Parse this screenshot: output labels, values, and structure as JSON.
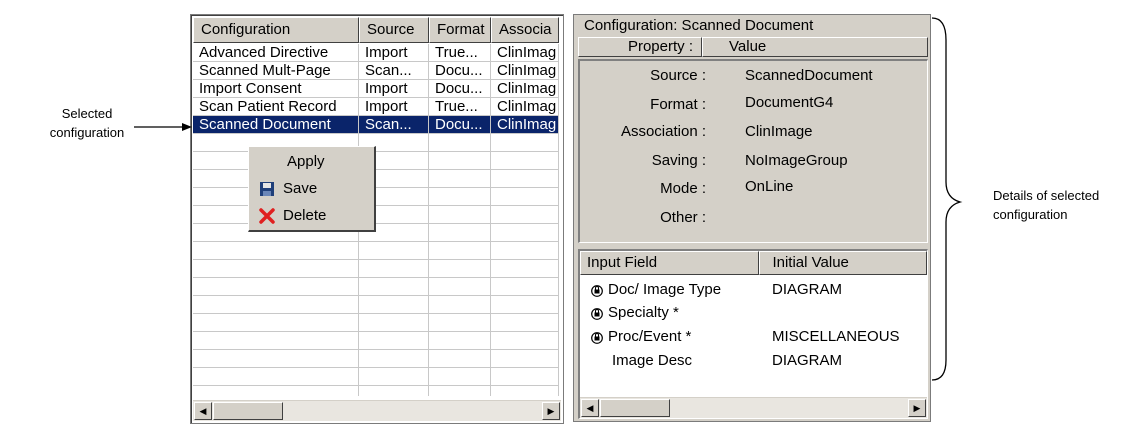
{
  "grid": {
    "columns": [
      "Configuration",
      "Source",
      "Format",
      "Associa"
    ],
    "rows": [
      [
        "Advanced Directive",
        "Import",
        "True...",
        "ClinImag"
      ],
      [
        "Scanned Mult-Page",
        "Scan...",
        "Docu...",
        "ClinImag"
      ],
      [
        "Import Consent",
        "Import",
        "Docu...",
        "ClinImag"
      ],
      [
        "Scan Patient Record",
        "Import",
        "True...",
        "ClinImag"
      ],
      [
        "Scanned Document",
        "Scan...",
        "Docu...",
        "ClinImag"
      ]
    ],
    "selected_row": "Scanned Document"
  },
  "context_menu": {
    "apply": "Apply",
    "save": "Save",
    "delete": "Delete"
  },
  "details": {
    "title": "Configuration: Scanned Document",
    "property_header": "Property :",
    "value_header": "Value",
    "properties": [
      {
        "label": "Source :",
        "value": "ScannedDocument"
      },
      {
        "label": "Format :",
        "value": "DocumentG4"
      },
      {
        "label": "Association :",
        "value": "ClinImage"
      },
      {
        "label": "Saving :",
        "value": "NoImageGroup"
      },
      {
        "label": "Mode :",
        "value": "OnLine"
      },
      {
        "label": "Other :",
        "value": ""
      }
    ],
    "input_header": "Input Field",
    "initial_header": "Initial Value",
    "inputs": [
      {
        "label": "Doc/ Image Type",
        "value": "DIAGRAM",
        "locked": true
      },
      {
        "label": "Specialty *",
        "value": "",
        "locked": true
      },
      {
        "label": "Proc/Event *",
        "value": "MISCELLANEOUS",
        "locked": true
      },
      {
        "label": "Image Desc",
        "value": "DIAGRAM",
        "locked": false
      }
    ]
  },
  "annotations": {
    "selected_line1": "Selected",
    "selected_line2": "configuration",
    "details_line1": "Details of selected",
    "details_line2": "configuration"
  },
  "colors": {
    "selection": "#0a246a",
    "face": "#d4d0c8",
    "delete_icon": "#e02020"
  }
}
